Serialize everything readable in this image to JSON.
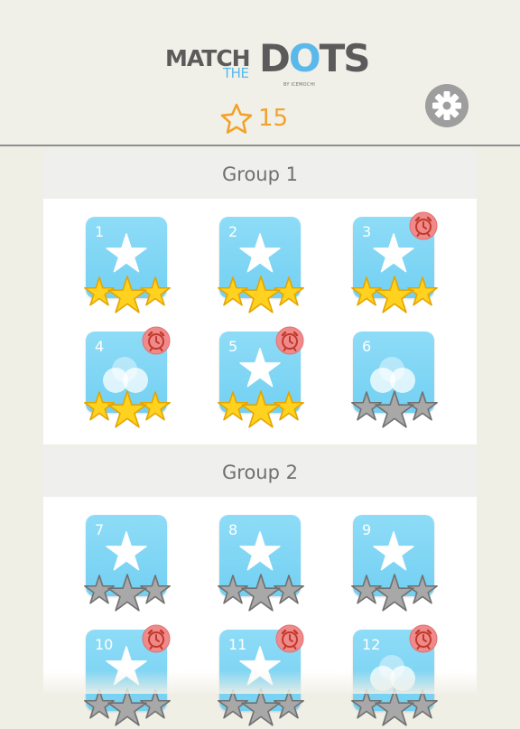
{
  "header": {
    "logo_match": "MATCH",
    "logo_the": "THE",
    "logo_dots_1": "D",
    "logo_dots_2": "O",
    "logo_dots_3": "TS",
    "logo_by": "BY ICEMOCHI",
    "star_total": "15",
    "settings_icon": "gear-icon"
  },
  "colors": {
    "accent_star": "#f2a22a",
    "tile": "#7fd6f5",
    "timer_badge": "#f08a8a",
    "gold_star": "#f7c400",
    "grey_star": "#8a8a8a"
  },
  "groups": [
    {
      "title": "Group 1",
      "levels": [
        {
          "number": "1",
          "icon": "star",
          "stars_earned": 3,
          "timed": false
        },
        {
          "number": "2",
          "icon": "star",
          "stars_earned": 3,
          "timed": false
        },
        {
          "number": "3",
          "icon": "star",
          "stars_earned": 3,
          "timed": true
        },
        {
          "number": "4",
          "icon": "dots",
          "stars_earned": 3,
          "timed": true
        },
        {
          "number": "5",
          "icon": "star",
          "stars_earned": 3,
          "timed": true
        },
        {
          "number": "6",
          "icon": "dots",
          "stars_earned": 0,
          "timed": false
        }
      ]
    },
    {
      "title": "Group 2",
      "levels": [
        {
          "number": "7",
          "icon": "star",
          "stars_earned": 0,
          "timed": false
        },
        {
          "number": "8",
          "icon": "star",
          "stars_earned": 0,
          "timed": false
        },
        {
          "number": "9",
          "icon": "star",
          "stars_earned": 0,
          "timed": false
        },
        {
          "number": "10",
          "icon": "star",
          "stars_earned": 0,
          "timed": true
        },
        {
          "number": "11",
          "icon": "star",
          "stars_earned": 0,
          "timed": true
        },
        {
          "number": "12",
          "icon": "dots",
          "stars_earned": 0,
          "timed": true
        }
      ]
    }
  ]
}
